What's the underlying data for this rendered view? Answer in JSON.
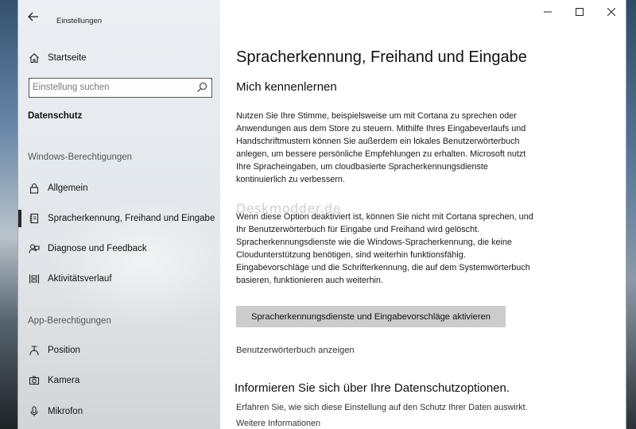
{
  "window": {
    "app_title": "Einstellungen",
    "controls": [
      "minimize-icon",
      "maximize-icon",
      "close-icon"
    ]
  },
  "sidebar": {
    "home_label": "Startseite",
    "search_placeholder": "Einstellung suchen",
    "section_title": "Datenschutz",
    "group_windows": "Windows-Berechtigungen",
    "windows_items": [
      {
        "label": "Allgemein",
        "icon": "lock-icon"
      },
      {
        "label": "Spracherkennung, Freihand und Eingabe",
        "icon": "notebook-icon",
        "active": true
      },
      {
        "label": "Diagnose und Feedback",
        "icon": "feedback-icon"
      },
      {
        "label": "Aktivitätsverlauf",
        "icon": "timeline-icon"
      }
    ],
    "group_apps": "App-Berechtigungen",
    "app_items": [
      {
        "label": "Position",
        "icon": "location-icon"
      },
      {
        "label": "Kamera",
        "icon": "camera-icon"
      },
      {
        "label": "Mikrofon",
        "icon": "microphone-icon"
      }
    ]
  },
  "content": {
    "page_title": "Spracherkennung, Freihand und Eingabe",
    "sub_title": "Mich kennenlernen",
    "paragraph1": "Nutzen Sie Ihre Stimme, beispielsweise um mit Cortana zu sprechen oder Anwendungen aus dem Store zu steuern. Mithilfe Ihres Eingabeverlaufs und Handschriftmustern können Sie außerdem ein lokales Benutzerwörterbuch anlegen, um bessere persönliche Empfehlungen zu erhalten. Microsoft nutzt Ihre Spracheingaben, um cloudbasierte Spracherkennungsdienste kontinuierlich zu verbessern.",
    "paragraph2": "Wenn diese Option deaktiviert ist, können Sie nicht mit Cortana sprechen, und Ihr Benutzerwörterbuch für Eingabe und Freihand wird gelöscht. Spracherkennungsdienste wie die Windows-Spracherkennung, die keine Cloudunterstützung benötigen, sind weiterhin funktionsfähig. Eingabevorschläge und die Schrifterkennung, die auf dem Systemwörterbuch basieren, funktionieren auch weiterhin.",
    "watermark": "Deskmodder.de",
    "action_button": "Spracherkennungsdienste und Eingabevorschläge aktivieren",
    "dictionary_link": "Benutzerwörterbuch anzeigen",
    "privacy_heading": "Informieren Sie sich über Ihre Datenschutzoptionen.",
    "privacy_text": "Erfahren Sie, wie sich diese Einstellung auf den Schutz Ihrer Daten auswirkt.",
    "privacy_more": "Weitere Informationen"
  }
}
